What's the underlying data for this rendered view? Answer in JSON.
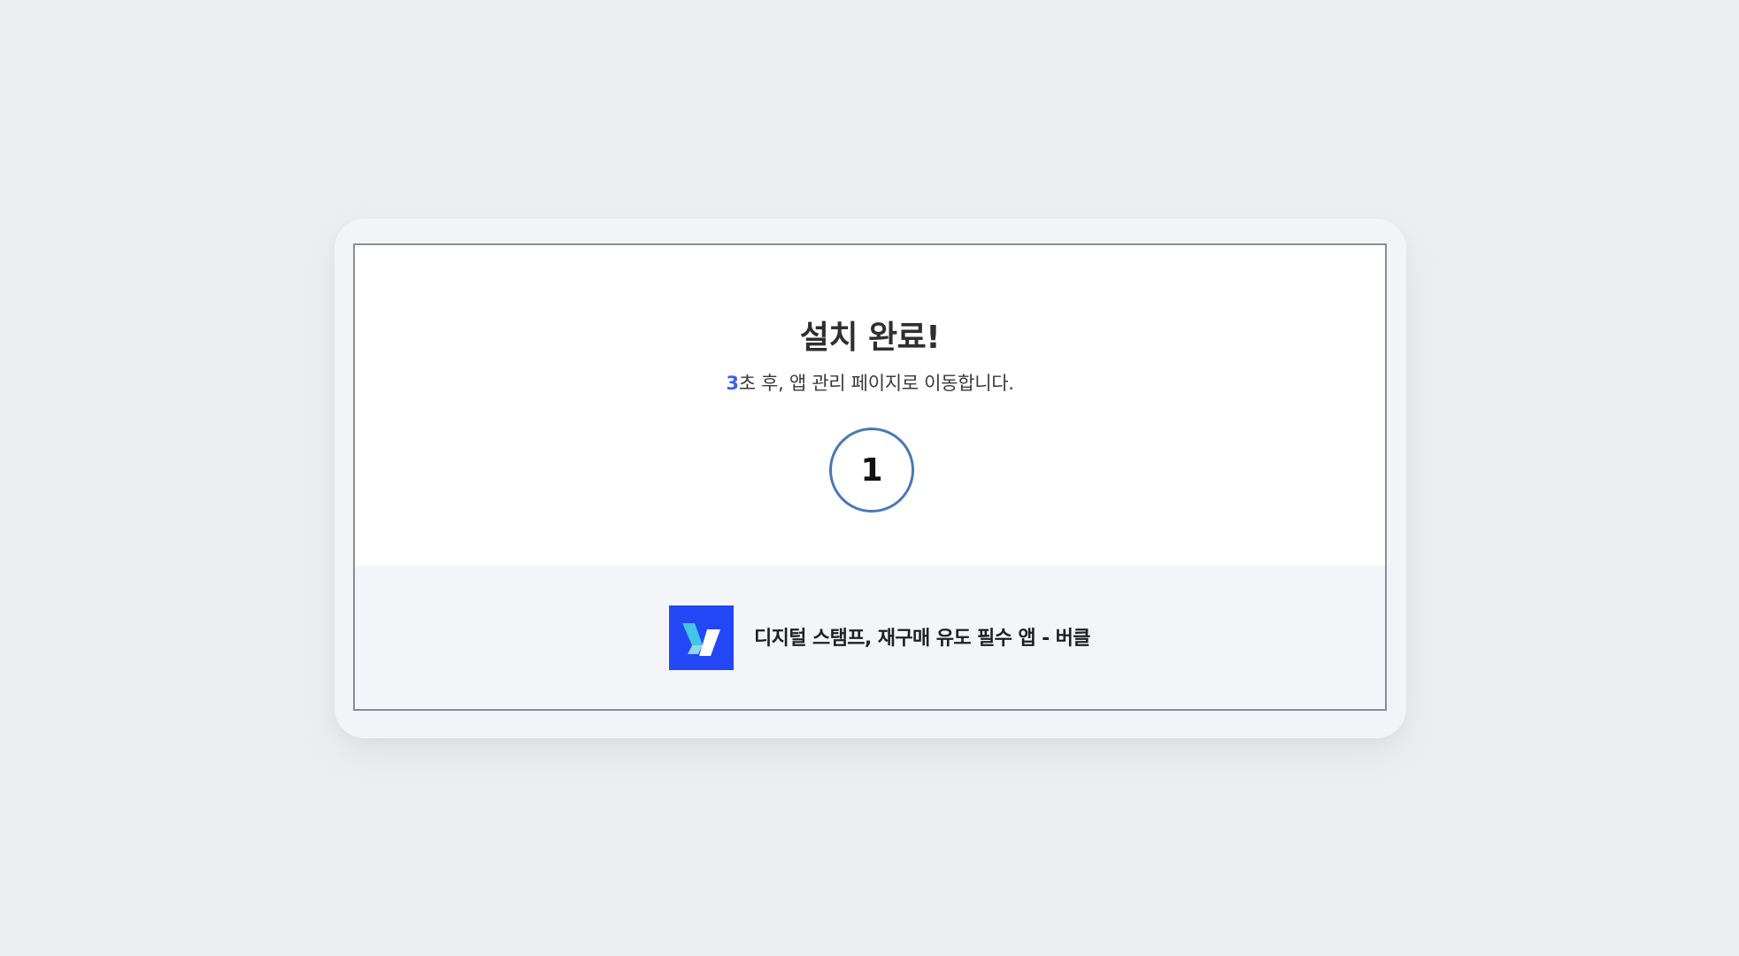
{
  "dialog": {
    "title": "설치 완료!",
    "redirect": {
      "seconds": "3",
      "message": "초 후, 앱 관리 페이지로 이동합니다."
    },
    "countdown_value": "1"
  },
  "app": {
    "name": "디지털 스탬프, 재구매 유도 필수 앱 - 버클",
    "logo_icon": "vercle-logo-icon"
  },
  "colors": {
    "page_background": "#edeef1",
    "accent": "#3e63dd",
    "countdown_ring": "#4a78b5",
    "logo_background": "#2347f4"
  }
}
